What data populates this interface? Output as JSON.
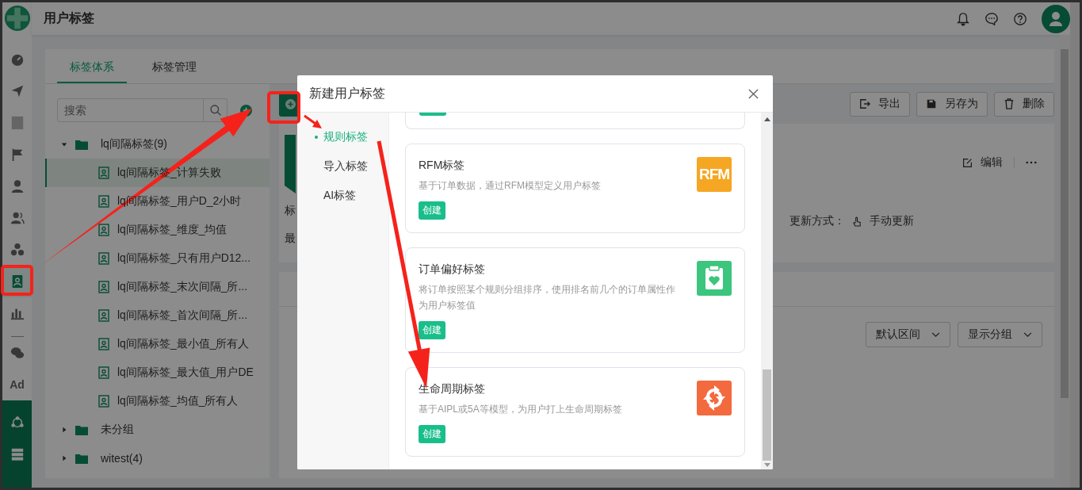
{
  "app": {
    "title": "用户标签"
  },
  "nav": {
    "items": [
      {
        "selected": false
      },
      {
        "selected": false
      },
      {
        "selected": false
      },
      {
        "selected": false
      },
      {
        "selected": false
      },
      {
        "selected": false
      },
      {
        "selected": false
      },
      {
        "selected": true
      },
      {
        "selected": false
      },
      {
        "selected": false
      },
      {
        "selected": false,
        "label": "Ad"
      }
    ]
  },
  "tabs": [
    {
      "label": "标签体系",
      "selected": true
    },
    {
      "label": "标签管理",
      "selected": false
    }
  ],
  "tree": {
    "search": {
      "placeholder": "搜索"
    },
    "groups": [
      {
        "label": "lq间隔标签(9)",
        "expanded": true,
        "children": [
          {
            "label": "lq间隔标签_计算失败",
            "selected": true
          },
          {
            "label": "lq间隔标签_用户D_2小时",
            "selected": false
          },
          {
            "label": "lq间隔标签_维度_均值",
            "selected": false
          },
          {
            "label": "lq间隔标签_只有用户D12...",
            "selected": false
          },
          {
            "label": "lq间隔标签_末次间隔_所...",
            "selected": false
          },
          {
            "label": "lq间隔标签_首次间隔_所...",
            "selected": false
          },
          {
            "label": "lq间隔标签_最小值_所有人",
            "selected": false
          },
          {
            "label": "lq间隔标签_最大值_用户DE",
            "selected": false
          },
          {
            "label": "lq间隔标签_均值_所有人",
            "selected": false
          }
        ]
      },
      {
        "label": "未分组",
        "expanded": false
      },
      {
        "label": "witest(4)",
        "expanded": false
      }
    ]
  },
  "toolbar": {
    "buttons": [
      "导出",
      "另存为",
      "删除"
    ]
  },
  "detail": {
    "fragments": [
      "标",
      "最"
    ],
    "edit": "编辑",
    "update_label": "更新方式：",
    "update_value": "手动更新"
  },
  "filters": [
    "默认区间",
    "显示分组"
  ],
  "modal": {
    "title": "新建用户标签",
    "menu": [
      {
        "label": "规则标签",
        "selected": true
      },
      {
        "label": "导入标签",
        "selected": false
      },
      {
        "label": "AI标签",
        "selected": false
      }
    ],
    "cards": [
      {
        "kind": "stub"
      },
      {
        "kind": "rfm",
        "title": "RFM标签",
        "description": "基于订单数据，通过RFM模型定义用户标签",
        "button": "创建",
        "badge_text": "RFM",
        "color": "#f5a623"
      },
      {
        "kind": "preference",
        "title": "订单偏好标签",
        "description": "将订单按照某个规则分组排序，使用排名前几个的订单属性作为用户标签值",
        "button": "创建",
        "color": "#3cc57d"
      },
      {
        "kind": "lifecycle",
        "title": "生命周期标签",
        "description": "基于AIPL或5A等模型，为用户打上生命周期标签",
        "button": "创建",
        "color": "#f26a3d"
      }
    ]
  }
}
